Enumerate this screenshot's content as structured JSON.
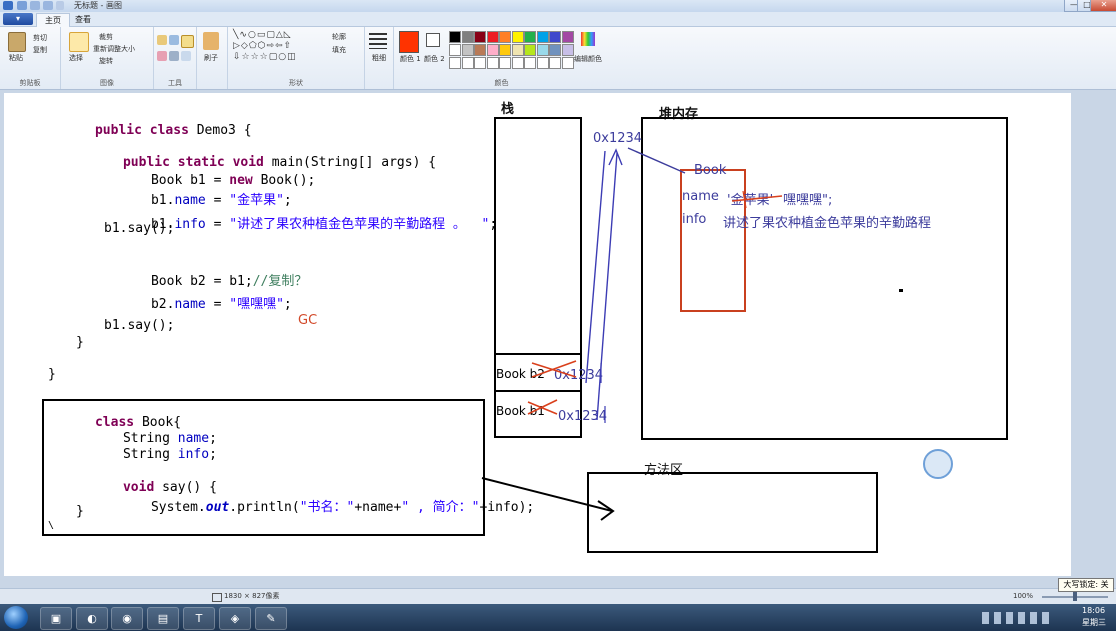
{
  "window": {
    "title": "无标题 - 画图",
    "buttons": {
      "minimize": "—",
      "maximize": "□",
      "close": "✕"
    }
  },
  "tabs": {
    "app_button": "▾",
    "items": [
      "主页",
      "查看"
    ],
    "active": "主页"
  },
  "ribbon": {
    "clipboard": {
      "paste": "粘贴",
      "cut": "剪切",
      "copy": "复制",
      "label": "剪贴板"
    },
    "image": {
      "select": "选择",
      "crop": "裁剪",
      "resize": "重新调整大小",
      "rotate": "旋转",
      "label": "图像"
    },
    "tools": {
      "label": "工具"
    },
    "brushes": {
      "label": "刷子"
    },
    "shapes": {
      "outline": "轮廓",
      "fill": "填充",
      "label": "形状"
    },
    "size": {
      "label": "粗细"
    },
    "colors": {
      "color1": "颜色 1",
      "color2": "颜色 2",
      "edit_colors": "编辑颜色",
      "label": "颜色",
      "palette": [
        "#000000",
        "#7f7f7f",
        "#880015",
        "#ed1c24",
        "#ff7f27",
        "#fff200",
        "#22b14c",
        "#00a2e8",
        "#3f48cc",
        "#a349a4",
        "#ffffff",
        "#c3c3c3",
        "#b97a57",
        "#ffaec9",
        "#ffc90e",
        "#efe4b0",
        "#b5e61d",
        "#99d9ea",
        "#7092be",
        "#c8bfe7"
      ],
      "color1_value": "#ff3300",
      "color2_value": "#ffffff"
    }
  },
  "canvas": {
    "code": {
      "class_decl": [
        "public",
        "class",
        "Demo3 {"
      ],
      "main_decl": [
        "public",
        "static",
        "void",
        "main(String[] args) {"
      ],
      "line_b1_new": [
        "Book b1 = ",
        "new",
        "Book();"
      ],
      "line_b1_name": [
        "b1.",
        "name",
        " = ",
        "\"金苹果\"",
        ";"
      ],
      "line_b1_info": [
        "b1.",
        "info",
        " = ",
        "\"讲述了果农种植金色苹果的辛勤路程 。  \"",
        ";"
      ],
      "line_b1_say1": "b1.say();",
      "line_b2": [
        "Book b2 = b1;",
        "//复制？"
      ],
      "line_b2_name": [
        "b2.",
        "name",
        " = ",
        "\"嘿嘿嘿\"",
        ";"
      ],
      "line_b1_say2": "b1.say();",
      "close_main": "}",
      "close_class": "}",
      "book_class": [
        "class",
        "Book{"
      ],
      "field_name": [
        "String ",
        "name",
        ";"
      ],
      "field_info": [
        "String ",
        "info",
        ";"
      ],
      "say_decl": [
        "void",
        "say() {"
      ],
      "println": [
        "System.",
        "out",
        ".println(",
        "\"书名：\"",
        "+name+",
        "\" , 简介：\"",
        "+info);"
      ],
      "close_say": "}",
      "close_book": "\\"
    },
    "annotations": {
      "gc": "GC",
      "stack_label": "栈",
      "heap_label": "堆内存",
      "method_area_label": "方法区",
      "address": "0x1234",
      "stack_b2": "Book  b2",
      "stack_b1": "Book  b1",
      "stack_b2_addr": "0x1234",
      "stack_b1_addr": "0x1234",
      "heap_obj_title": "Book",
      "heap_name_label": "name",
      "heap_name_old": "'金苹果'",
      "heap_name_new": "嘿嘿嘿\";",
      "heap_info_label": "info",
      "heap_info_value": "讲述了果农种植金色苹果的辛勤路程"
    }
  },
  "statusbar": {
    "dimensions": "1830 × 827像素",
    "zoom": "100%"
  },
  "caps_badge": "大写锁定: 关",
  "taskbar": {
    "clock_time": "18:06",
    "clock_day": "星期三",
    "apps": [
      "start-orb",
      "paint-app",
      "eclipse-app",
      "chrome-app",
      "notes-app",
      "typora-app",
      "media-app",
      "paint-alt-app"
    ]
  }
}
